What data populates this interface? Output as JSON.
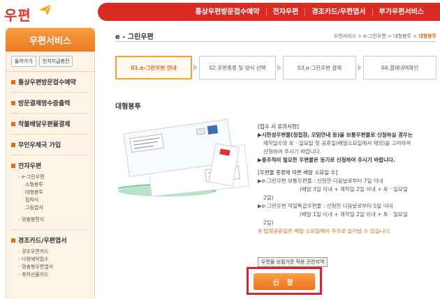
{
  "header": {
    "logo_text": "우편",
    "nav": [
      "통상우편방문접수예약",
      "전자우편",
      "경조카드/우편엽서",
      "부가우편서비스"
    ]
  },
  "sidebar": {
    "title": "우편서비스",
    "buttons": [
      "들어가기",
      "전지지급충전"
    ],
    "menu": [
      {
        "label": "통상우편방문접수예약"
      },
      {
        "label": "방문결제영수증출력"
      },
      {
        "label": "착불배달우편물결제"
      },
      {
        "label": "무인우체국 가입"
      },
      {
        "label": "전자우편",
        "sub": [
          {
            "label": "e-그린우편",
            "children": [
              "소형봉투",
              "대형봉투",
              "접착식",
              "그림엽서"
            ]
          },
          {
            "label": "맞춤형편지"
          }
        ]
      },
      {
        "label": "경조카드/우편엽서",
        "sub": [
          {
            "label": "경조우편카드"
          },
          {
            "label": "다량예약접수"
          },
          {
            "label": "맞춤형우편엽서"
          },
          {
            "label": "축하선물카드"
          }
        ]
      }
    ]
  },
  "main": {
    "title": "e - 그린우편",
    "breadcrumb": [
      "우편서비스",
      "e-그린우편",
      "대형봉투"
    ],
    "breadcrumb_current": "대형봉투",
    "breadcrumb_sep": ">",
    "steps": [
      "01.e-그린우편 안내",
      "02.우편종류 및 양식 선택",
      "03.e-그린우편 결제",
      "04.결제내역확인"
    ],
    "section_title": "대형봉투",
    "info": {
      "head1": "[접수 시 유의사항]",
      "l1": "▶시한성우편물(청첩장, 모임안내 등)을 보통우편물로 신청하실 경우는",
      "l2": "제작일수와 토 · 일요일 및 공휴일(배달소요일에서 제외)을 고려하여",
      "l3": "신청하여 주시기 바랍니다.",
      "l4": "▶종추적이 필요한 우편물은 등기로 신청하여 주시기 바랍니다.",
      "head2": "[우편물 종류에 따른 배달 소요일 수]",
      "l5": "▶e-그린우편 보통우편물 : 신청한 다음날로부터 7일 이내",
      "l6": "(배달 3일 이내 + 제작일 2일 이내 + 토 · 일요일",
      "l7": "2일)",
      "l8": "▶e-그린우편 익일특급우편물 : 신청한 다음날로부터 5일 이내",
      "l9": "(배달 1일 이내 + 제작일 2일 이내 + 토 · 일요일",
      "l10": "2일)",
      "note": "※ 법정공휴일은 배달 소요일에서 추가로 늘어날 수 있습니다."
    },
    "standard_button": "우편물 승필기준 적용 곤란지역",
    "apply_button": "신 청"
  },
  "colors": {
    "brand_red": "#d92b22",
    "accent_orange": "#ec7a1f",
    "highlight_red": "#d9232d"
  }
}
